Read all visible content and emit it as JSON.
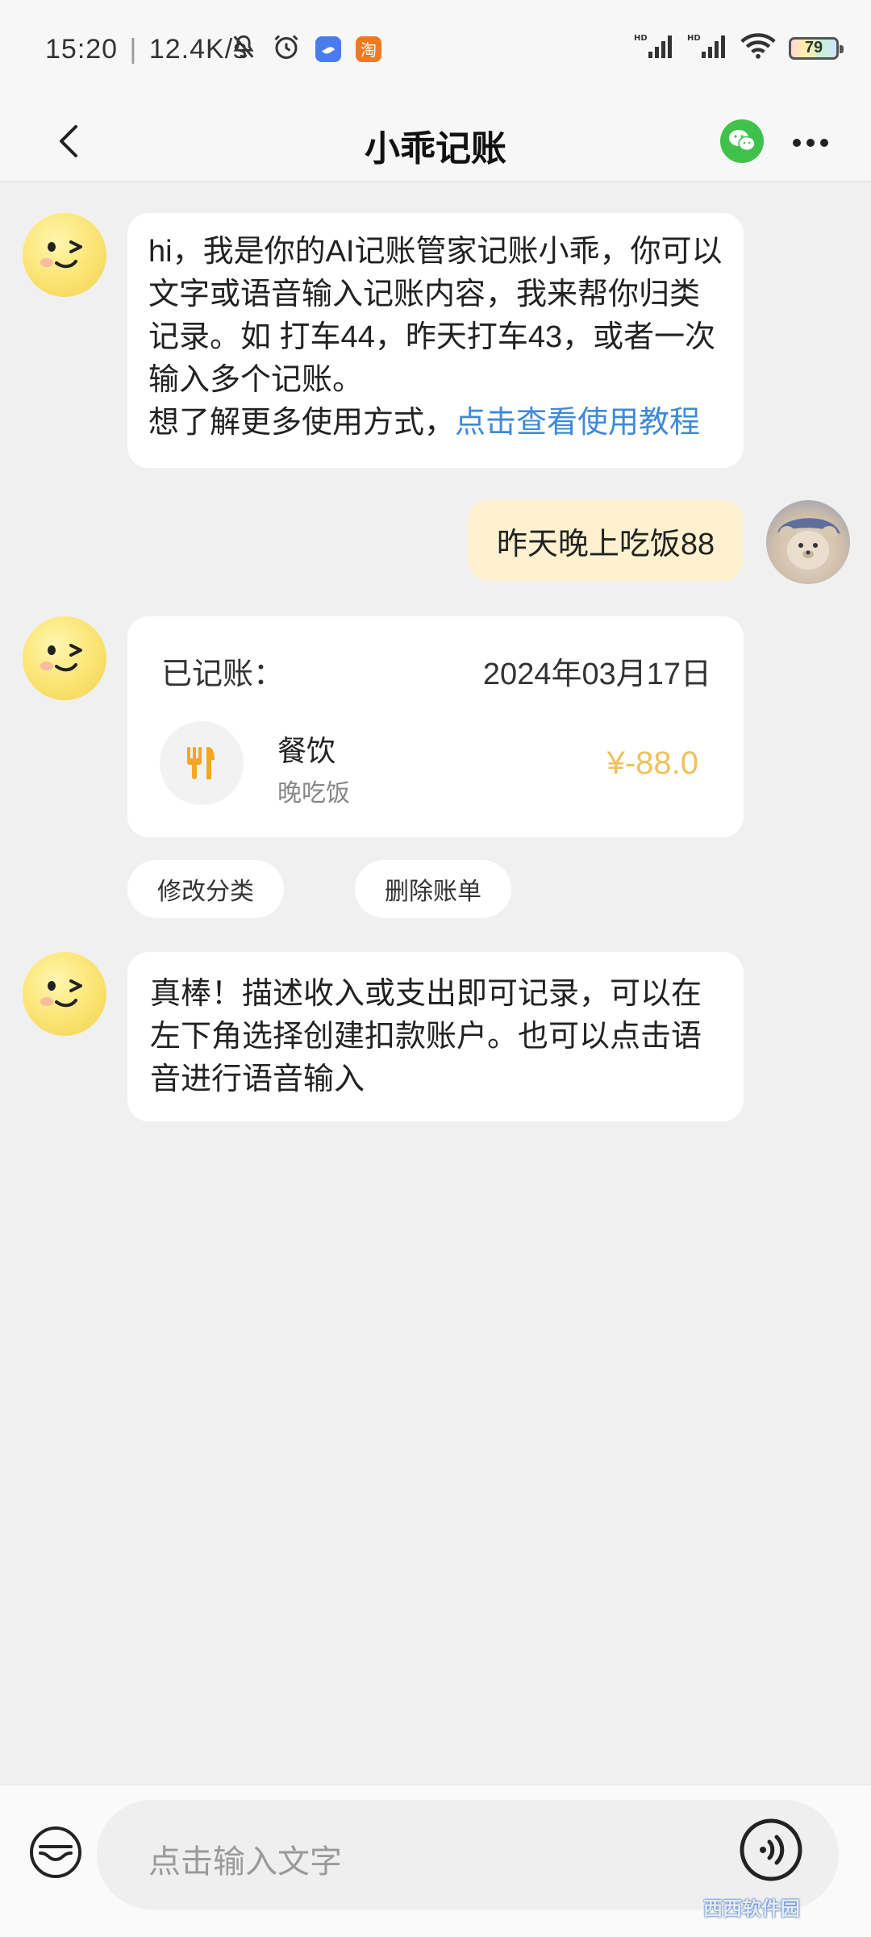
{
  "status_bar": {
    "time": "15:20",
    "net_speed": "12.4K/s",
    "battery": "79",
    "taobao_badge": "淘"
  },
  "header": {
    "title": "小乖记账"
  },
  "chat": {
    "bot_intro": {
      "text": "hi，我是你的AI记账管家记账小乖，你可以文字或语音输入记账内容，我来帮你归类记录。如 打车44，昨天打车43，或者一次输入多个记账。",
      "prompt": "想了解更多使用方式，",
      "tutorial_link": "点击查看使用教程"
    },
    "user_message": "昨天晚上吃饭88",
    "record_card": {
      "header": "已记账：",
      "date": "2024年03月17日",
      "category": "餐饮",
      "note": "晚吃饭",
      "amount": "¥-88.0"
    },
    "actions": {
      "edit_category": "修改分类",
      "delete_bill": "删除账单"
    },
    "bot_followup": "真棒！描述收入或支出即可记录，可以在左下角选择创建扣款账户。也可以点击语音进行语音输入"
  },
  "input": {
    "placeholder": "点击输入文字"
  },
  "watermark": "西西软件园",
  "colors": {
    "background": "#f0f0f0",
    "user_bubble": "#fdf1cf",
    "link": "#3f89d9",
    "amount": "#f0c05a",
    "wechat": "#3ec24b",
    "category_icon": "#f5a623"
  }
}
